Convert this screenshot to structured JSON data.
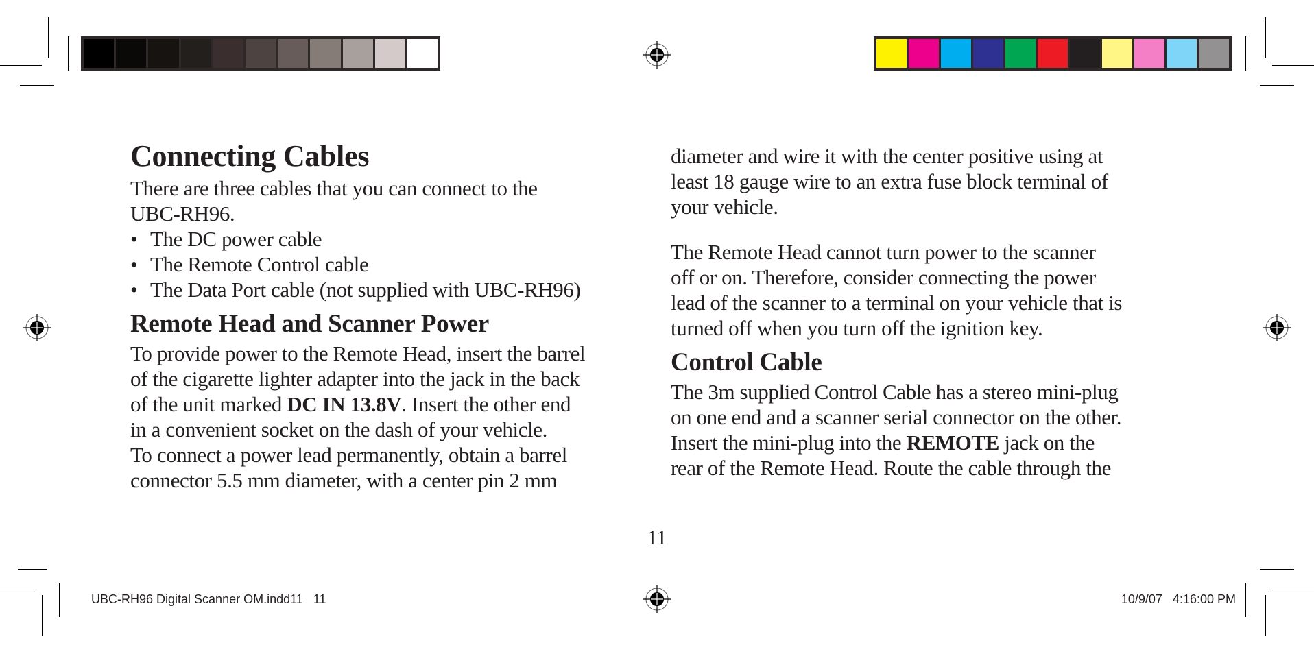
{
  "print_marks": {
    "grayscale_swatches": [
      "#000000",
      "#0b0908",
      "#171311",
      "#231f1c",
      "#3a2f2e",
      "#4d4341",
      "#685c5a",
      "#857b77",
      "#a8a09d",
      "#d4cac9",
      "#ffffff"
    ],
    "color_swatches": [
      "#fff200",
      "#ec008c",
      "#00aeef",
      "#2e3192",
      "#00a651",
      "#ed1c24",
      "#231f20",
      "#fff685",
      "#f47fc6",
      "#7fd5f7",
      "#939192"
    ]
  },
  "left_column": {
    "title": "Connecting Cables",
    "intro_line1": "There are three cables that you can connect to the",
    "intro_line2": "UBC-RH96.",
    "bullets": [
      {
        "symbol": "•",
        "text": "The DC power cable"
      },
      {
        "symbol": "•",
        "text": "The Remote Control cable"
      },
      {
        "symbol": "•",
        "text": "The Data Port cable (not supplied with UBC-RH96)"
      }
    ],
    "section_heading": "Remote Head and Scanner Power",
    "para_lines": {
      "l1": "To provide power to the Remote Head, insert the barrel",
      "l2": "of the cigarette lighter adapter into the jack in the back",
      "l3_pre": "of the unit marked ",
      "l3_bold": "DC IN 13.8V",
      "l3_post": ". Insert the other end",
      "l4": "in a convenient socket on the dash of your vehicle.",
      "l5": "To connect a power lead permanently, obtain a barrel",
      "l6": "connector 5.5 mm diameter, with a center pin 2 mm"
    }
  },
  "right_column": {
    "para1_lines": {
      "l1": "diameter and wire it with the center positive using at",
      "l2": "least 18 gauge wire to an extra fuse block terminal of",
      "l3": "your vehicle."
    },
    "para2_lines": {
      "l1": "The Remote Head cannot turn power to the scanner",
      "l2": "off or on. Therefore, consider connecting the power",
      "l3": "lead of the scanner to a terminal on your vehicle that is",
      "l4": "turned off when you turn off the ignition key."
    },
    "section_heading": "Control Cable",
    "para3_lines": {
      "l1": "The 3m supplied Control Cable has a stereo mini-plug",
      "l2": "on one end and a scanner serial connector on the other.",
      "l3_pre": "Insert the mini-plug into the ",
      "l3_bold": "REMOTE",
      "l3_post": " jack on the",
      "l4": "rear of the Remote Head. Route the cable through the"
    }
  },
  "page_number": "11",
  "footer": {
    "file_info": "UBC-RH96 Digital Scanner OM.indd11   11",
    "timestamp": "10/9/07   4:16:00 PM"
  }
}
